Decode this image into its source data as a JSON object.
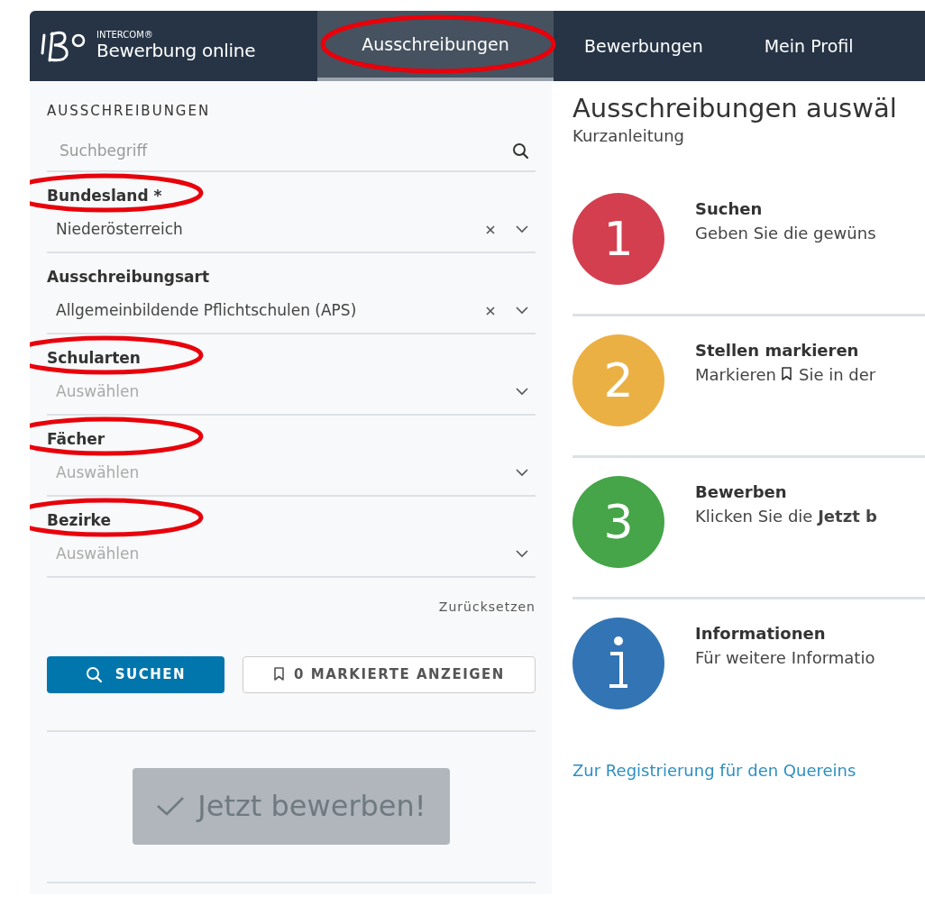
{
  "navbar": {
    "brand_small": "INTERCOM®",
    "brand": "Bewerbung online",
    "tabs": [
      {
        "label": "Ausschreibungen",
        "selected": true,
        "circled": true
      },
      {
        "label": "Bewerbungen",
        "selected": false,
        "circled": false
      },
      {
        "label": "Mein Profil",
        "selected": false,
        "circled": false
      }
    ]
  },
  "sidebar": {
    "heading": "AUSSCHREIBUNGEN",
    "search": {
      "placeholder": "Suchbegriff"
    },
    "filters": [
      {
        "label": "Bundesland *",
        "value": "Niederösterreich",
        "circled": true
      },
      {
        "label": "Ausschreibungsart",
        "value": "Allgemeinbildende Pflichtschulen (APS)",
        "circled": false
      },
      {
        "label": "Schularten",
        "placeholder": "Auswählen",
        "circled": true
      },
      {
        "label": "Fächer",
        "placeholder": "Auswählen",
        "circled": true
      },
      {
        "label": "Bezirke",
        "placeholder": "Auswählen",
        "circled": true
      }
    ],
    "reset": "Zurücksetzen",
    "search_button": "SUCHEN",
    "marked_button": "0 MARKIERTE ANZEIGEN",
    "apply_button": {
      "label": "Jetzt bewerben!",
      "disabled": true
    }
  },
  "main": {
    "title": "Ausschreibungen auswäl",
    "subtitle": "Kurzanleitung",
    "steps": [
      {
        "kind": "number",
        "badge": "1",
        "color": "#d33f4f",
        "title": "Suchen",
        "text": "Geben Sie die gewüns"
      },
      {
        "kind": "number",
        "badge": "2",
        "color": "#ebb044",
        "title": "Stellen markieren",
        "text": "Markieren",
        "text_after_icon": "Sie in der"
      },
      {
        "kind": "number",
        "badge": "3",
        "color": "#45a548",
        "title": "Bewerben",
        "text": "Klicken Sie die **Jetzt b**"
      },
      {
        "kind": "info",
        "color": "#3374b4",
        "title": "Informationen",
        "text": "Für weitere Informatio"
      }
    ],
    "link": "Zur Registrierung für den Quereins"
  }
}
